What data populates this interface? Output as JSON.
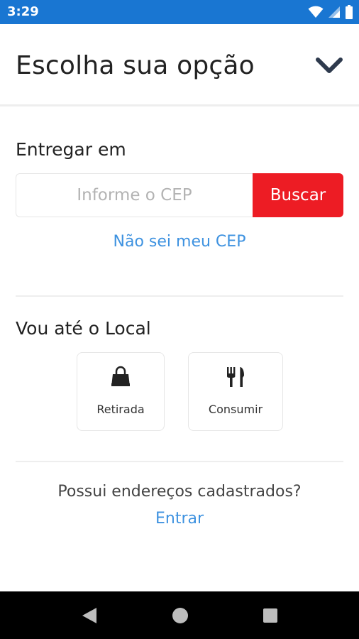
{
  "status_bar": {
    "time": "3:29",
    "icons": [
      "wifi-icon",
      "signal-icon",
      "battery-icon"
    ]
  },
  "header": {
    "title": "Escolha sua opção",
    "toggle_icon": "chevron-down-icon"
  },
  "delivery": {
    "title": "Entregar em",
    "cep_placeholder": "Informe o CEP",
    "cep_value": "",
    "search_label": "Buscar",
    "unknown_cep_link": "Não sei meu CEP"
  },
  "pickup": {
    "title": "Vou até o Local",
    "options": [
      {
        "label": "Retirada",
        "icon": "shopping-bag-icon"
      },
      {
        "label": "Consumir",
        "icon": "fork-knife-icon"
      }
    ]
  },
  "account": {
    "question": "Possui endereços cadastrados?",
    "login_link": "Entrar"
  },
  "nav_bar": {
    "buttons": [
      "back-icon",
      "home-icon",
      "recents-icon"
    ]
  },
  "colors": {
    "status_bar": "#1976d2",
    "accent_red": "#ed1c24",
    "link_blue": "#3e92e0",
    "nav_bar": "#000000"
  }
}
